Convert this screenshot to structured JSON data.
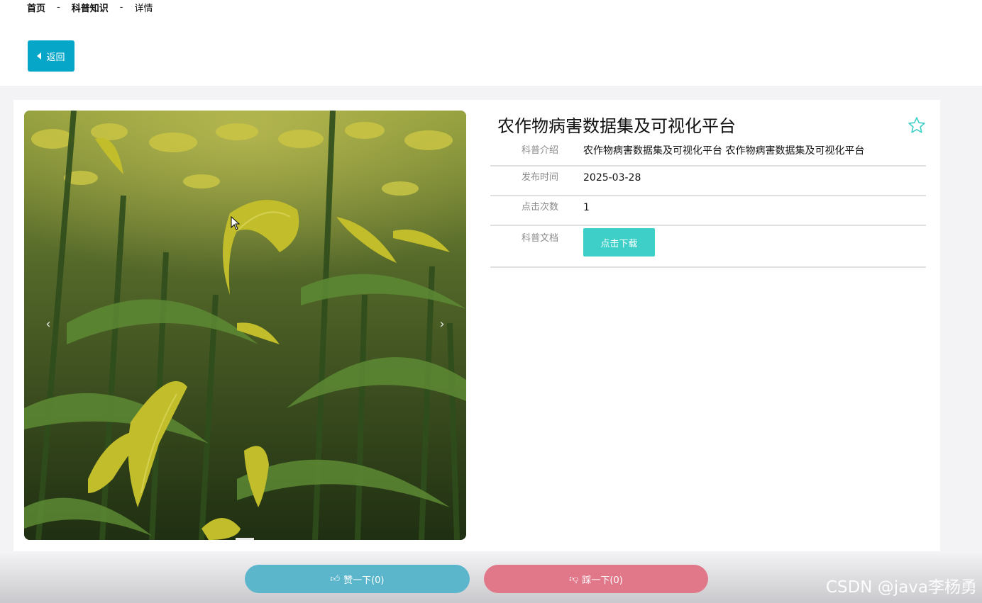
{
  "breadcrumb": {
    "items": [
      "首页",
      "科普知识",
      "详情"
    ],
    "separator": "-"
  },
  "back_button": {
    "label": "返回",
    "color": "#06a6c8"
  },
  "detail": {
    "title": "农作物病害数据集及可视化平台",
    "fields": [
      {
        "label": "科普介绍",
        "value": "农作物病害数据集及可视化平台 农作物病害数据集及可视化平台"
      },
      {
        "label": "发布时间",
        "value": "2025-03-28"
      },
      {
        "label": "点击次数",
        "value": "1"
      },
      {
        "label": "科普文档",
        "button": "点击下载"
      }
    ],
    "favorite_icon": "star-outline-icon",
    "accent": "#3fcfc9"
  },
  "carousel": {
    "prev": "‹",
    "next": "›"
  },
  "votes": {
    "like_label": "赞一下(0)",
    "dislike_label": "踩一下(0)",
    "like_color": "#5bb6cc",
    "dislike_color": "#e0788a"
  },
  "watermark": "CSDN @java李杨勇"
}
